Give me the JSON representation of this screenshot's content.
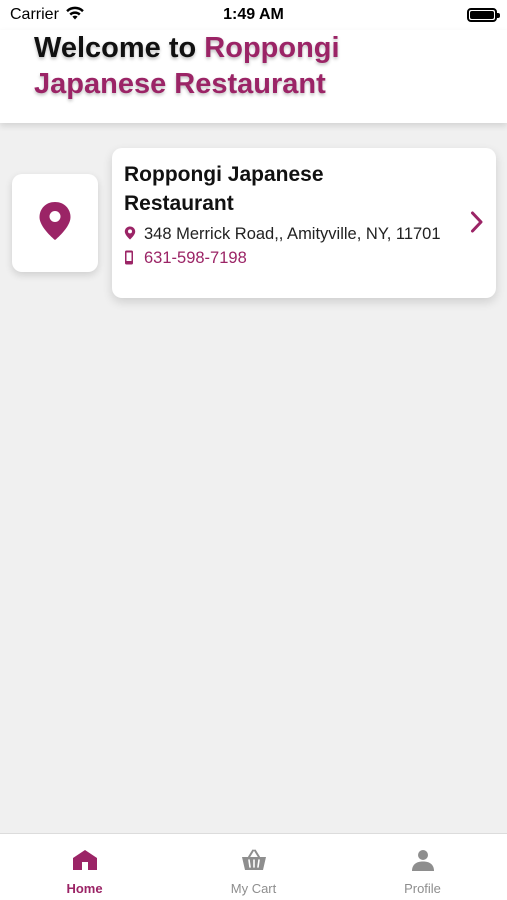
{
  "status_bar": {
    "carrier": "Carrier",
    "time": "1:49 AM"
  },
  "header": {
    "welcome_prefix": "Welcome to ",
    "restaurant_name": "Roppongi Japanese Restaurant"
  },
  "restaurant_card": {
    "name": "Roppongi Japanese Restaurant",
    "address": "348 Merrick Road,, Amityville, NY, 11701",
    "phone": "631-598-7198"
  },
  "tab_bar": {
    "tabs": [
      {
        "label": "Home",
        "icon": "home-icon",
        "active": true
      },
      {
        "label": "My Cart",
        "icon": "basket-icon",
        "active": false
      },
      {
        "label": "Profile",
        "icon": "person-icon",
        "active": false
      }
    ]
  },
  "colors": {
    "accent": "#9b2466",
    "inactive": "#8e8e8e",
    "background": "#f0f0f0"
  }
}
